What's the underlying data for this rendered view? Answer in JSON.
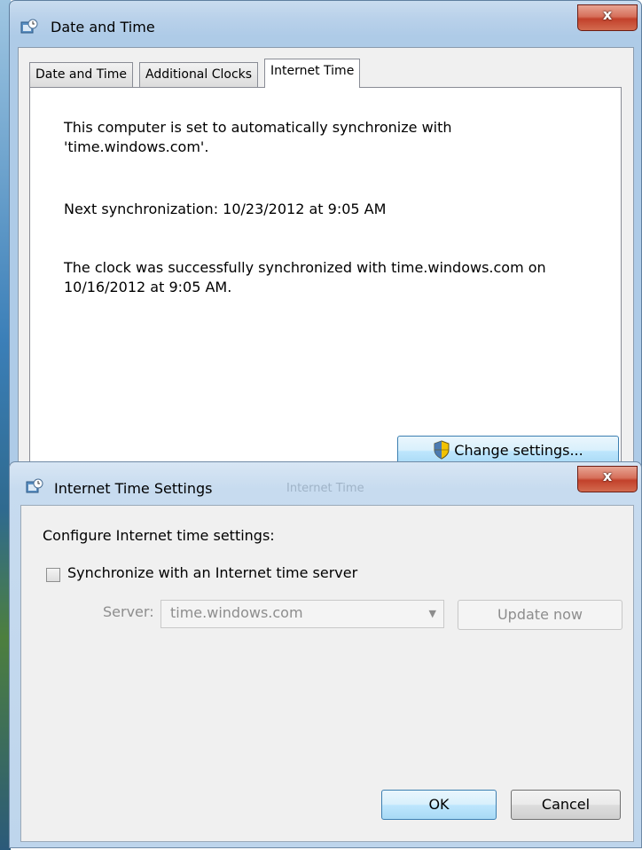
{
  "window_main": {
    "title": "Date and Time",
    "close_glyph": "x",
    "tabs": [
      {
        "label": "Date and Time",
        "active": false
      },
      {
        "label": "Additional Clocks",
        "active": false
      },
      {
        "label": "Internet Time",
        "active": true
      }
    ],
    "info_line1": "This computer is set to automatically synchronize with",
    "info_line2": "'time.windows.com'.",
    "next_sync": "Next synchronization: 10/23/2012 at 9:05 AM",
    "last_sync_line1": "The clock was successfully synchronized with time.windows.com on",
    "last_sync_line2": "10/16/2012 at 9:05 AM.",
    "change_settings_label": "Change settings..."
  },
  "window_dialog": {
    "title": "Internet Time Settings",
    "ghost_texts": [
      "Internet Time"
    ],
    "close_glyph": "x",
    "heading": "Configure Internet time settings:",
    "sync_checkbox_label": "Synchronize with an Internet time server",
    "sync_checked": false,
    "server_label": "Server:",
    "server_value": "time.windows.com",
    "update_now_label": "Update now",
    "ok_label": "OK",
    "cancel_label": "Cancel"
  },
  "icons": {
    "app": "date-time-icon",
    "uac": "uac-shield-icon",
    "close": "close-icon",
    "dropdown": "chevron-down-icon"
  },
  "colors": {
    "title_bar": "#aecbe7",
    "close_button": "#c2412b",
    "dialog_face": "#f0f0f0",
    "disabled_text": "#8d8d8d"
  }
}
